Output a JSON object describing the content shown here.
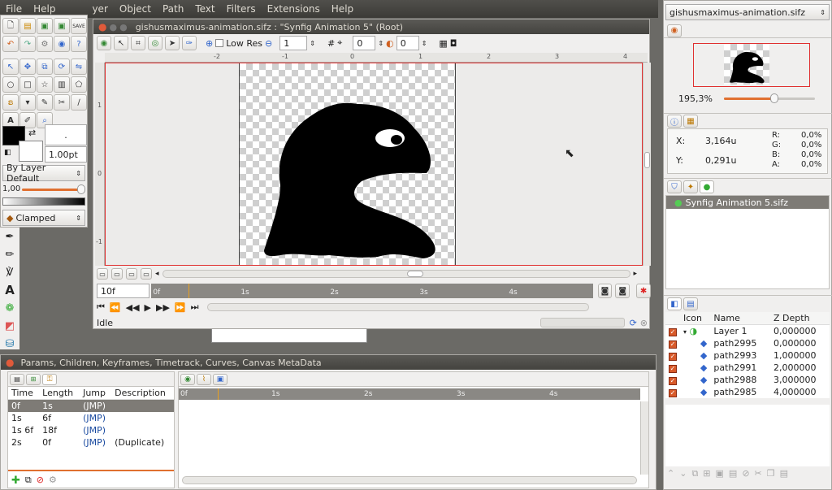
{
  "menubar": {
    "items": [
      "File",
      "Help",
      "yer",
      "Object",
      "Path",
      "Text",
      "Filters",
      "Extensions",
      "Help"
    ]
  },
  "canvas_window": {
    "title": "gishusmaximus-animation.sifz : \"Synfig Animation 5\" (Root)",
    "low_res_label": "Low Res",
    "quality_value": "1",
    "onion_past": "0",
    "onion_future": "0",
    "ruler_labels": [
      "-2",
      "-1",
      "0",
      "1",
      "2",
      "3",
      "4"
    ],
    "vruler_labels": [
      "1",
      "0",
      "-1"
    ],
    "current_time": "10f",
    "timebar_labels": [
      "0f",
      "1s",
      "2s",
      "3s",
      "4s"
    ],
    "status": "Idle"
  },
  "toolbox": {
    "brush_size": "1.00pt",
    "blend_method": "By Layer Default",
    "opacity_value": "1,00",
    "interpolation": "Clamped",
    "outline_color": "#000000",
    "fill_color": "#ffffff"
  },
  "params_panel": {
    "title": "Params, Children, Keyframes, Timetrack, Curves, Canvas MetaData",
    "columns": [
      "Time",
      "Length",
      "Jump",
      "Description"
    ],
    "rows": [
      {
        "time": "0f",
        "length": "1s",
        "jump": "(JMP)",
        "description": ""
      },
      {
        "time": "1s",
        "length": "6f",
        "jump": "(JMP)",
        "description": ""
      },
      {
        "time": "1s 6f",
        "length": "18f",
        "jump": "(JMP)",
        "description": ""
      },
      {
        "time": "2s",
        "length": "0f",
        "jump": "(JMP)",
        "description": "(Duplicate)"
      }
    ],
    "timetrack_labels": [
      "0f",
      "1s",
      "2s",
      "3s",
      "4s"
    ]
  },
  "right_panel": {
    "file_selector": "gishusmaximus-animation.sifz",
    "zoom": "195,3%",
    "zoom_fraction": 0.55,
    "info": {
      "x_label": "X:",
      "x_value": "3,164u",
      "y_label": "Y:",
      "y_value": "0,291u",
      "r_label": "R:",
      "r_value": "0,0%",
      "g_label": "G:",
      "g_value": "0,0%",
      "b_label": "B:",
      "b_value": "0,0%",
      "a_label": "A:",
      "a_value": "0,0%"
    },
    "canvas_browser_item": "Synfig Animation 5.sifz",
    "layers_columns": [
      "Icon",
      "Name",
      "Z Depth"
    ],
    "layers": [
      {
        "name": "Layer 1",
        "depth": "0,000000"
      },
      {
        "name": "path2995",
        "depth": "0,000000"
      },
      {
        "name": "path2993",
        "depth": "1,000000"
      },
      {
        "name": "path2991",
        "depth": "2,000000"
      },
      {
        "name": "path2988",
        "depth": "3,000000"
      },
      {
        "name": "path2985",
        "depth": "4,000000"
      }
    ]
  },
  "colors": {
    "accent": "#e07030",
    "selection": "#7e7b76",
    "canvas_border": "#e03030"
  }
}
